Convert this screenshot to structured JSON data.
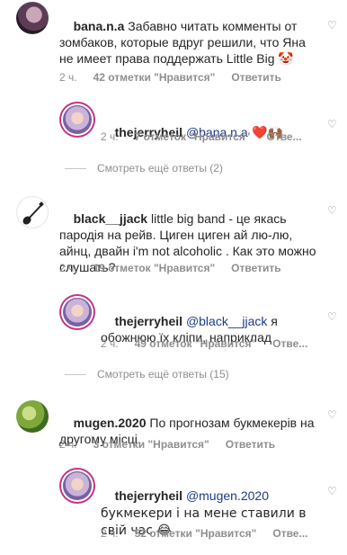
{
  "comments": [
    {
      "username": "bana.n.a",
      "text": "Забавно читать комменты от зомбаков, которые вдруг решили, что Яна не имеет права поддержать Little Big 🤡",
      "time": "2 ч.",
      "likes": "42 отметки \"Нравится\"",
      "reply": "Ответить",
      "avatar_icon": "avatar-bana",
      "reply_comment": {
        "username": "thejerryheil",
        "mention": "@bana.n.a",
        "text": " ❤️🙌🏾",
        "time": "2 ч.",
        "likes": "7 отметок \"Нравится\"",
        "reply": "Отве..."
      },
      "more_replies": "Смотреть ещё ответы (2)"
    },
    {
      "username": "black__jjack",
      "text": "little big band - це якась пародія на рейв. Циген циген ай лю-лю, айнц, двайн i'm not alcoholic . Как это можно слушать?",
      "time": "2 ч.",
      "likes": "19 отметок \"Нравится\"",
      "reply": "Ответить",
      "avatar_icon": "guitar-icon",
      "reply_comment": {
        "username": "thejerryheil",
        "mention": "@black__jjack",
        "text": " я обожнюю їх кліпи, наприклад",
        "time": "2 ч.",
        "likes": "49 отметок \"Нравится\"",
        "reply": "Отве..."
      },
      "more_replies": "Смотреть ещё ответы (15)"
    },
    {
      "username": "mugen.2020",
      "text": "По прогнозам букмекерів на другому місці.",
      "time": "2 ч.",
      "likes": "3 отметки \"Нравится\"",
      "reply": "Ответить",
      "avatar_icon": "avatar-mugen",
      "reply_comment": {
        "username": "thejerryheil",
        "mention": "@mugen.2020",
        "text": " букмекери і на мене ставили в свій час 😂",
        "time": "2 ч.",
        "likes": "52 отметки \"Нравится\"",
        "reply": "Отве..."
      }
    }
  ],
  "heart_icon": "heart-outline-icon",
  "colors": {
    "text": "#262626",
    "meta": "#8e8e8e",
    "mention": "#1e3a8a"
  }
}
